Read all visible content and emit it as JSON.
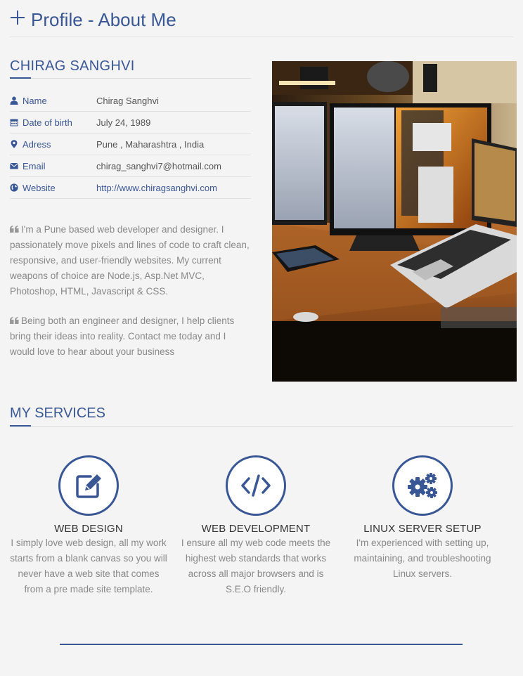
{
  "page": {
    "title": "Profile - About Me"
  },
  "profile": {
    "name_heading": "CHIRAG SANGHVI",
    "fields": [
      {
        "icon": "user-icon",
        "label": "Name",
        "value": "Chirag Sanghvi"
      },
      {
        "icon": "calendar-icon",
        "label": "Date of birth",
        "value": "July 24, 1989"
      },
      {
        "icon": "map-marker-icon",
        "label": "Adress",
        "value": "Pune , Maharashtra , India"
      },
      {
        "icon": "envelope-icon",
        "label": "Email",
        "value": "chirag_sanghvi7@hotmail.com"
      },
      {
        "icon": "globe-icon",
        "label": "Website",
        "value": "http://www.chiragsanghvi.com"
      }
    ],
    "bio": [
      "I'm a Pune based web developer and designer. I passionately move pixels and lines of code to craft clean, responsive, and user-friendly websites. My current weapons of choice are Node.js, Asp.Net MVC, Photoshop, HTML, Javascript & CSS.",
      "Being both an engineer and designer, I help clients bring their ideas into reality. Contact me today and I would love to hear about your business"
    ]
  },
  "services": {
    "heading": "MY SERVICES",
    "items": [
      {
        "icon": "edit-icon",
        "title": "WEB DESIGN",
        "text": "I simply love web design, all my work starts from a blank canvas so you will never have a web site that comes from a pre made site template."
      },
      {
        "icon": "code-icon",
        "title": "WEB DEVELOPMENT",
        "text": "I ensure all my web code meets the highest web standards that works across all major browsers and is S.E.O friendly."
      },
      {
        "icon": "gears-icon",
        "title": "LINUX SERVER SETUP",
        "text": "I'm experienced with setting up, maintaining, and troubleshooting Linux servers."
      }
    ]
  },
  "colors": {
    "accent": "#3a5795",
    "background": "#f4f4f4",
    "muted_text": "#888888"
  }
}
